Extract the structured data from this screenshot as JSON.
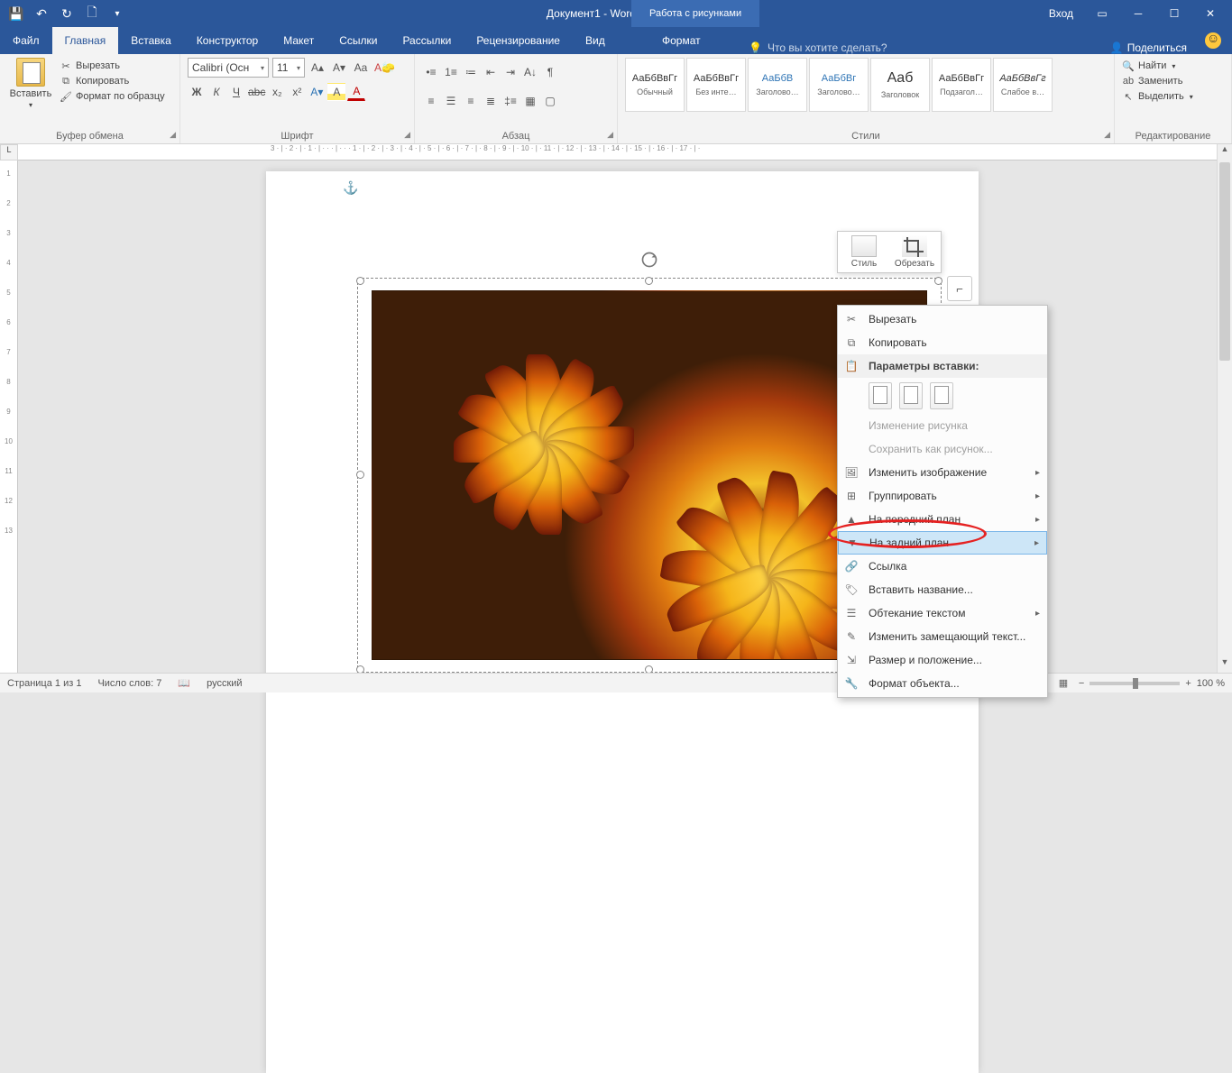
{
  "titlebar": {
    "doc_title": "Документ1 - Word",
    "tool_context": "Работа с рисунками",
    "login": "Вход"
  },
  "tabs": {
    "file": "Файл",
    "home": "Главная",
    "insert": "Вставка",
    "design": "Конструктор",
    "layout": "Макет",
    "references": "Ссылки",
    "mailings": "Рассылки",
    "review": "Рецензирование",
    "view": "Вид",
    "format": "Формат",
    "tellme_placeholder": "Что вы хотите сделать?",
    "share": "Поделиться"
  },
  "ribbon": {
    "clipboard": {
      "paste": "Вставить",
      "cut": "Вырезать",
      "copy": "Копировать",
      "formatpainter": "Формат по образцу",
      "group": "Буфер обмена"
    },
    "font": {
      "name": "Calibri (Осн",
      "size": "11",
      "group": "Шрифт"
    },
    "paragraph": {
      "group": "Абзац"
    },
    "styles": {
      "group": "Стили",
      "preview": "АаБбВвГг",
      "preview_title": "Aаб",
      "items": [
        "Обычный",
        "Без инте…",
        "Заголово…",
        "Заголово…",
        "Заголовок",
        "Подзагол…",
        "Слабое в…"
      ]
    },
    "editing": {
      "find": "Найти",
      "replace": "Заменить",
      "select": "Выделить",
      "group": "Редактирование"
    }
  },
  "ruler_h_text": "3 · | · 2 · | · 1 · | · · · | · · · 1 · | · 2 · | · 3 · | · 4 · | · 5 · | · 6 · | · 7 · | · 8 · | · 9 · | · 10 · | · 11 · | · 12 · | · 13 · | · 14 · | · 15 · | · 16 · | · 17 · | ·",
  "ruler_v": [
    "1",
    "2",
    "3",
    "4",
    "5",
    "6",
    "7",
    "8",
    "9",
    "10",
    "11",
    "12",
    "13"
  ],
  "minitb": {
    "style": "Стиль",
    "crop": "Обрезать"
  },
  "context_menu": {
    "cut": "Вырезать",
    "copy": "Копировать",
    "paste_options": "Параметры вставки:",
    "edit_picture": "Изменение рисунка",
    "save_as_picture": "Сохранить как рисунок...",
    "change_picture": "Изменить изображение",
    "group": "Группировать",
    "bring_front": "На передний план",
    "send_back": "На задний план",
    "link": "Ссылка",
    "insert_caption": "Вставить название...",
    "text_wrap": "Обтекание текстом",
    "edit_alt_text": "Изменить замещающий текст...",
    "size_position": "Размер и положение...",
    "format_object": "Формат объекта..."
  },
  "statusbar": {
    "page": "Страница 1 из 1",
    "words": "Число слов: 7",
    "lang": "русский",
    "zoom": "100 %"
  }
}
